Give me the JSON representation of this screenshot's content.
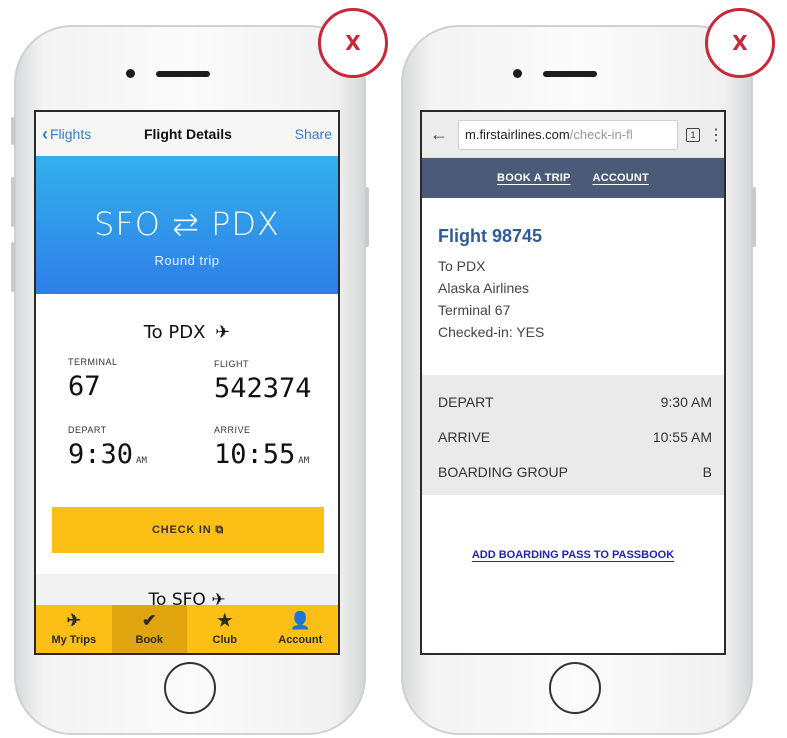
{
  "badges": {
    "left": "X",
    "right": "X"
  },
  "app": {
    "nav": {
      "back_label": "Flights",
      "title": "Flight Details",
      "share_label": "Share"
    },
    "hero": {
      "route": "SFO ⇆ PDX",
      "trip_type": "Round trip"
    },
    "outbound": {
      "title": "To PDX",
      "terminal_label": "TERMINAL",
      "terminal_value": "67",
      "flight_label": "FLIGHT",
      "flight_value": "542374",
      "depart_label": "DEPART",
      "depart_time": "9:30",
      "depart_ampm": "AM",
      "arrive_label": "ARRIVE",
      "arrive_time": "10:55",
      "arrive_ampm": "AM"
    },
    "checkin_label": "CHECK IN ⧉",
    "return_title": "To SFO",
    "tabs": [
      {
        "label": "My Trips",
        "icon": "plane-icon"
      },
      {
        "label": "Book",
        "icon": "check-icon"
      },
      {
        "label": "Club",
        "icon": "star-icon"
      },
      {
        "label": "Account",
        "icon": "person-icon"
      }
    ],
    "active_tab": "Book",
    "colors": {
      "accent_yellow": "#fbbf16",
      "hero_blue": "#2e7fe8",
      "link_blue": "#2f7ed8"
    }
  },
  "web": {
    "url_domain": "m.firstairlines.com",
    "url_path": "/check-in-fl",
    "tab_count": "1",
    "nav": {
      "book": "BOOK A TRIP",
      "account": "ACCOUNT"
    },
    "flight": {
      "number": "Flight 98745",
      "to": "To PDX",
      "airline": "Alaska Airlines",
      "terminal": "Terminal 67",
      "checked_in": "Checked-in: YES"
    },
    "rows": [
      {
        "label": "DEPART",
        "value": "9:30 AM"
      },
      {
        "label": "ARRIVE",
        "value": "10:55 AM"
      },
      {
        "label": "BOARDING GROUP",
        "value": "B"
      }
    ],
    "passbook_link": "ADD BOARDING PASS TO PASSBOOK",
    "colors": {
      "header_bg": "#4a5a78",
      "flight_title": "#2f5b9a",
      "link": "#2323b8"
    }
  }
}
